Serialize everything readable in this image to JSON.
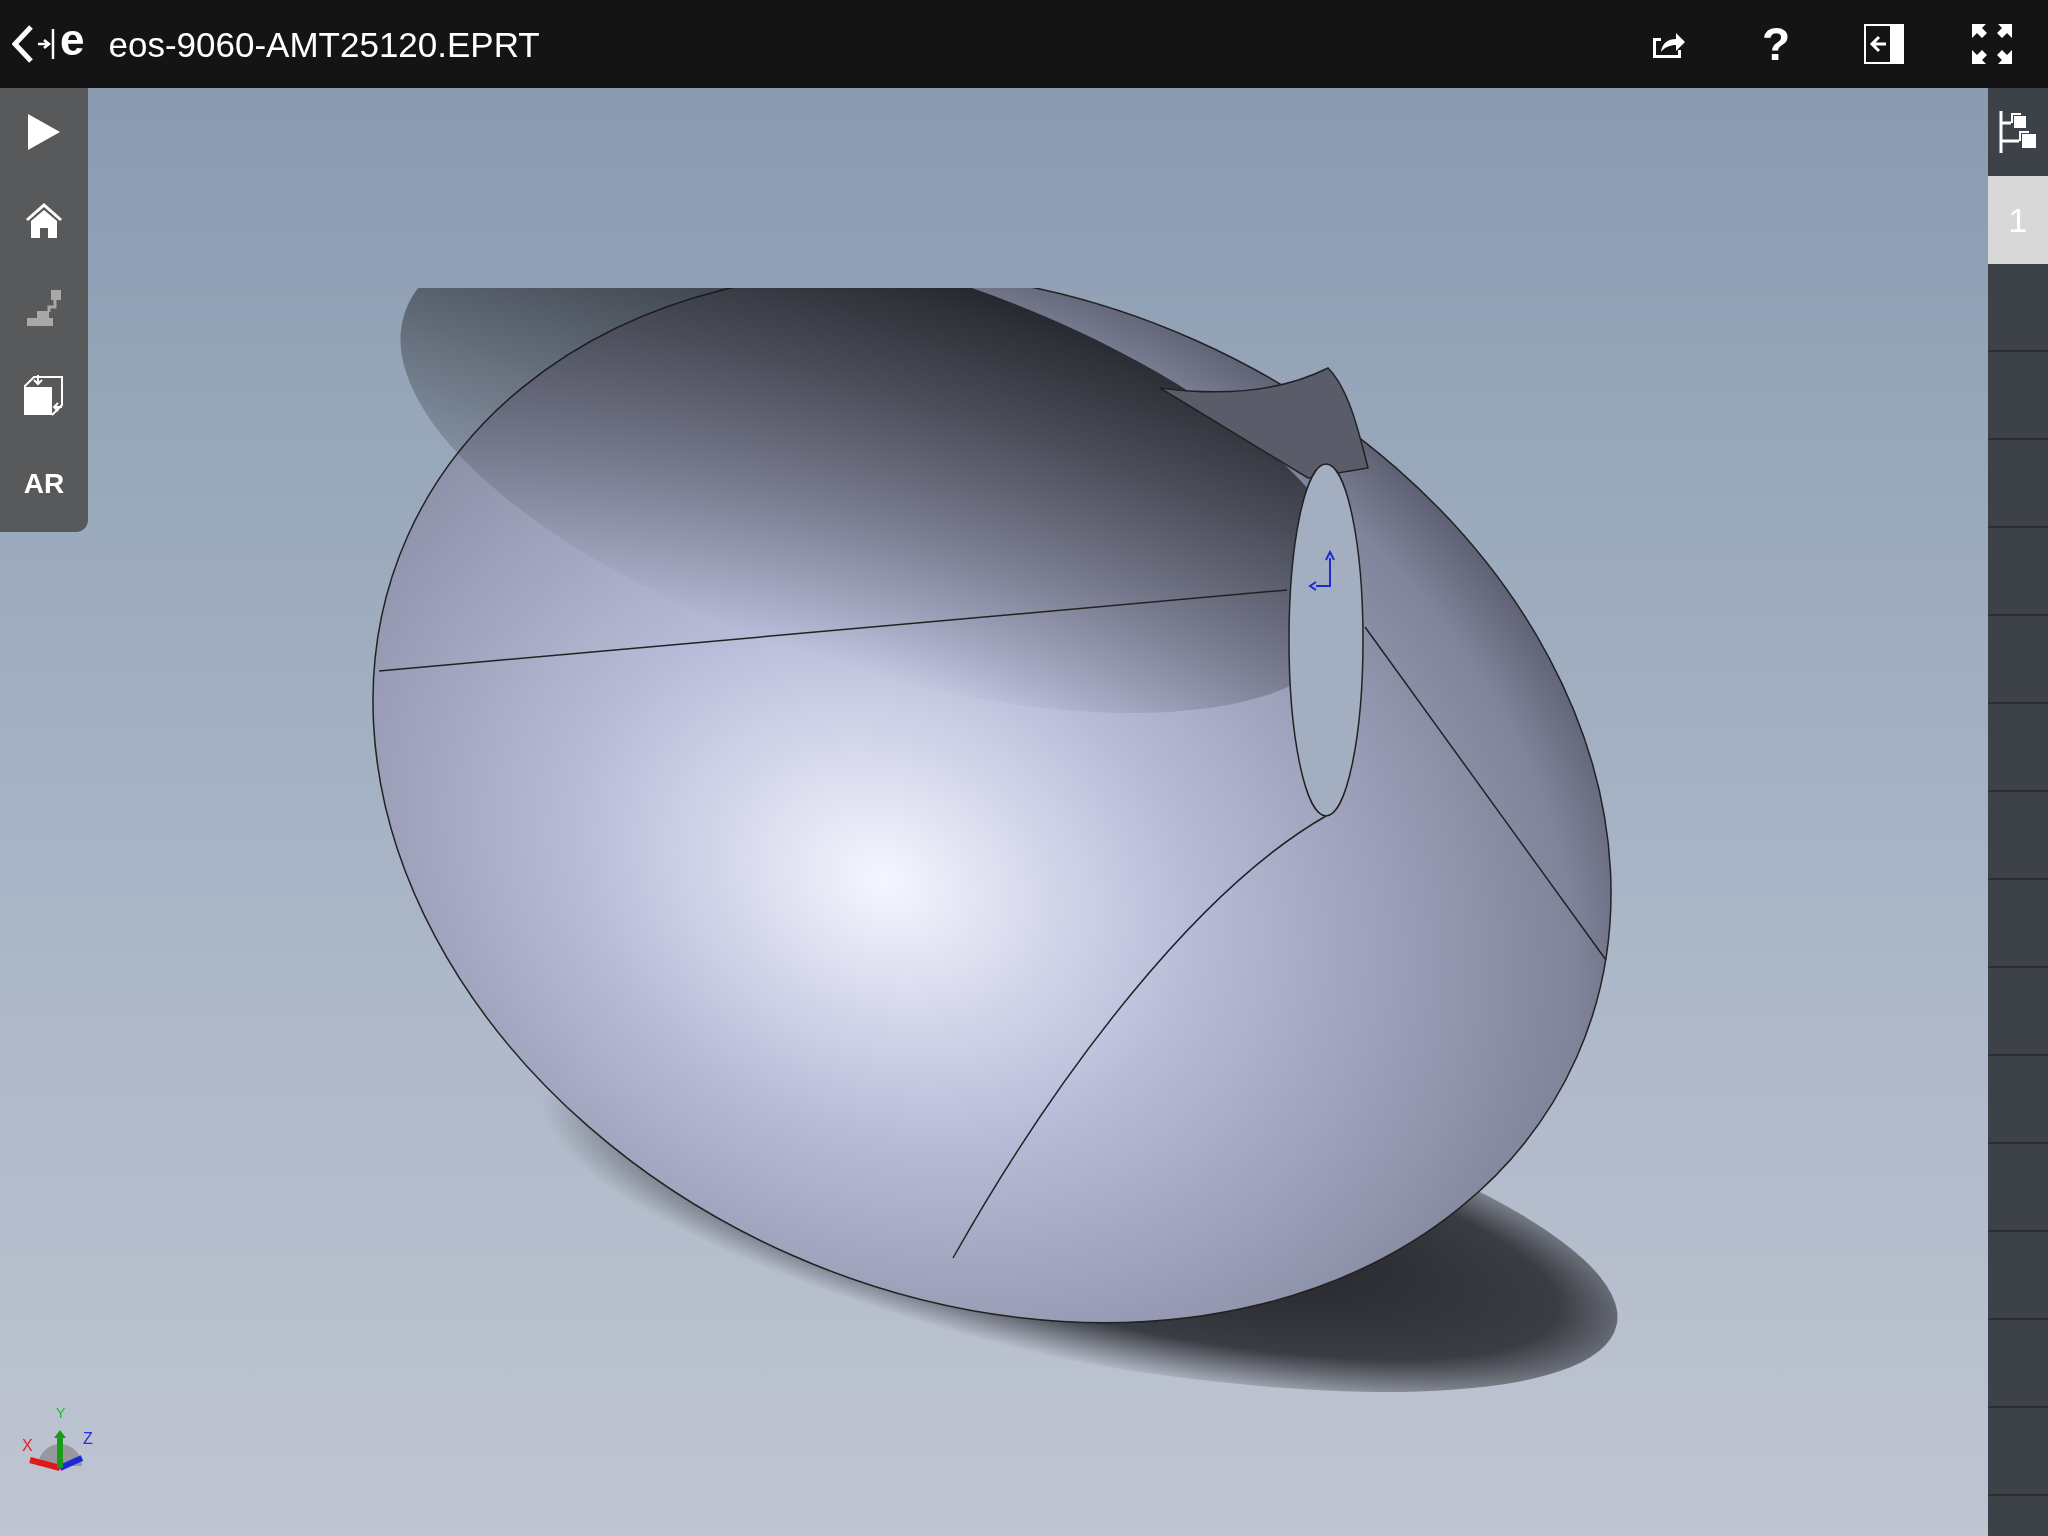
{
  "logo": "e",
  "title": "eos-9060-AMT25120.EPRT",
  "header_actions": [
    {
      "kind": "share"
    },
    {
      "kind": "help",
      "label": "?"
    },
    {
      "kind": "panel"
    },
    {
      "kind": "fullscreen"
    }
  ],
  "toolbar": [
    {
      "kind": "play",
      "disabled": false
    },
    {
      "kind": "home",
      "disabled": false
    },
    {
      "kind": "explode",
      "disabled": true
    },
    {
      "kind": "views",
      "disabled": false
    },
    {
      "kind": "ar",
      "label": "AR",
      "disabled": false
    }
  ],
  "configurations": [
    {
      "label": "1",
      "selected": true
    }
  ],
  "triad": {
    "x": "X",
    "y": "Y",
    "z": "Z"
  }
}
